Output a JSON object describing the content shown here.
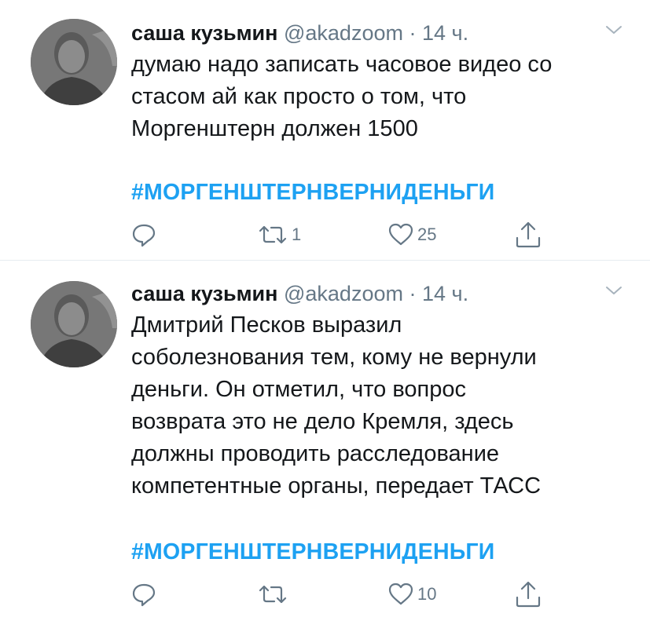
{
  "tweets": [
    {
      "author_name": "саша кузьмин",
      "handle": "@akadzoom",
      "separator": "·",
      "time": "14 ч.",
      "text": "думаю надо записать часовое видео со\nстасом ай как просто о том, что\nМоргенштерн должен 1500",
      "hashtag": "#МОРГЕНШТЕРНВЕРНИДЕНЬГИ",
      "reply_count": "",
      "retweet_count": "1",
      "like_count": "25"
    },
    {
      "author_name": "саша кузьмин",
      "handle": "@akadzoom",
      "separator": "·",
      "time": "14 ч.",
      "text": "Дмитрий Песков выразил\nсоболезнования тем, кому не вернули\nденьги. Он отметил, что вопрос\nвозврата это не дело Кремля, здесь\nдолжны проводить расследование\nкомпетентные органы, передает ТАСС",
      "hashtag": "#МОРГЕНШТЕРНВЕРНИДЕНЬГИ",
      "reply_count": "",
      "retweet_count": "",
      "like_count": "10"
    }
  ],
  "colors": {
    "hashtag": "#1da1f2",
    "secondary": "#657786",
    "text": "#14171a",
    "divider": "#e6ecf0"
  },
  "icons": {
    "avatar": "user-avatar",
    "menu": "chevron-down-icon",
    "reply": "reply-icon",
    "retweet": "retweet-icon",
    "like": "heart-icon",
    "share": "share-icon"
  }
}
